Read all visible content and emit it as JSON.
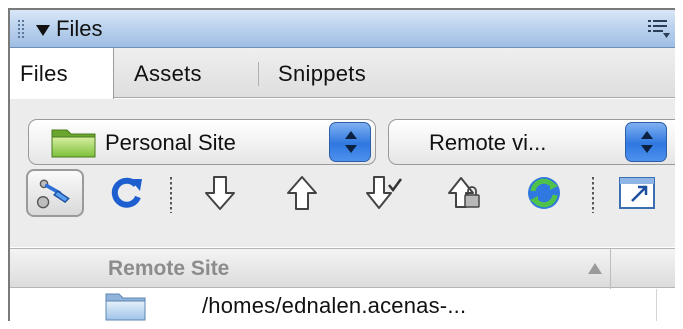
{
  "panel": {
    "title": "Files"
  },
  "tabs": [
    {
      "label": "Files",
      "active": true
    },
    {
      "label": "Assets",
      "active": false
    },
    {
      "label": "Snippets",
      "active": false
    }
  ],
  "site_select": {
    "value": "Personal Site"
  },
  "view_select": {
    "value": "Remote vi..."
  },
  "toolbar": {
    "buttons": [
      "connect-icon",
      "refresh-icon",
      "get-icon",
      "put-icon",
      "check-out-icon",
      "check-in-icon",
      "synchronize-icon",
      "expand-icon"
    ]
  },
  "file_list": {
    "column": "Remote Site",
    "rows": [
      {
        "name": "/homes/ednalen.acenas-..."
      }
    ]
  },
  "colors": {
    "title_bar": "#bcd3ee",
    "stepper": "#2f78e0",
    "refresh": "#1e5fd0",
    "sync": "#2f9a3a"
  }
}
